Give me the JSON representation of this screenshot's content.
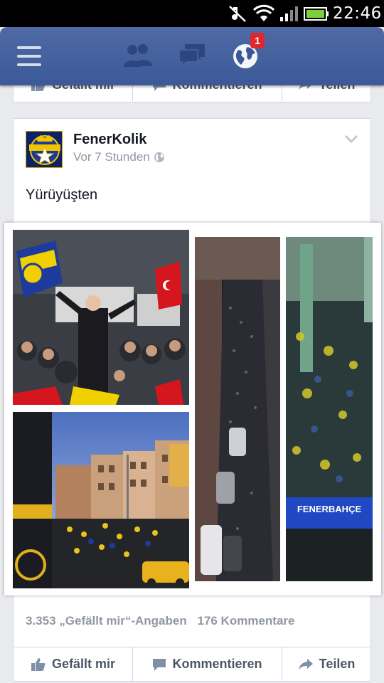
{
  "status_bar": {
    "time": "22:46",
    "icons": [
      "mute-icon",
      "wifi-icon",
      "signal-icon",
      "battery-icon"
    ]
  },
  "top_bar": {
    "icons": [
      "menu-icon",
      "friend-requests-icon",
      "messages-icon",
      "notifications-globe-icon"
    ],
    "notification_count": "1",
    "colors": {
      "bar": "#3b5998",
      "badge": "#e0262e"
    }
  },
  "previous_post": {
    "actions": {
      "like": "Gefällt mir",
      "comment": "Kommentieren",
      "share": "Teilen"
    }
  },
  "post": {
    "author": "FenerKolik",
    "time": "Vor 7 Stunden",
    "audience_icon": "globe-icon",
    "text": "Yürüyüşten",
    "photo_caption_text": "FENERBAHÇE",
    "likes": "3.353 „Gefällt mir“-Angaben",
    "comments": "176 Kommentare",
    "actions": {
      "like": "Gefällt mir",
      "comment": "Kommentieren",
      "share": "Teilen"
    }
  }
}
